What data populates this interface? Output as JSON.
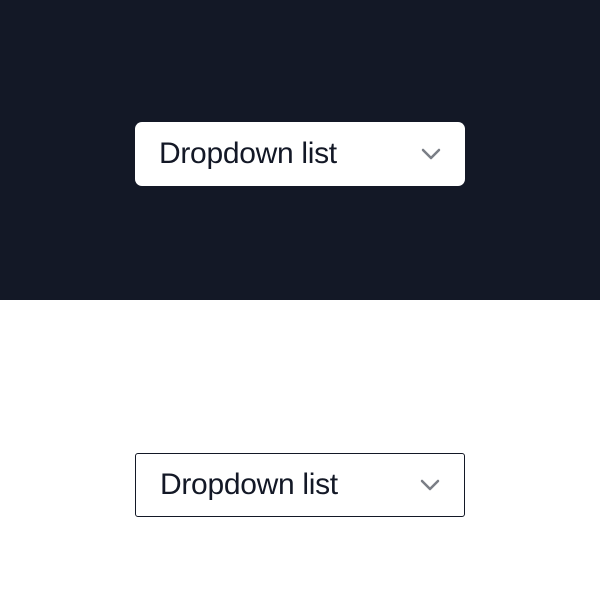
{
  "dropdowns": {
    "dark": {
      "label": "Dropdown list"
    },
    "light": {
      "label": "Dropdown list"
    }
  },
  "colors": {
    "dark_bg": "#131826",
    "light_bg": "#ffffff",
    "text": "#131826",
    "chevron": "#7a7e86"
  }
}
